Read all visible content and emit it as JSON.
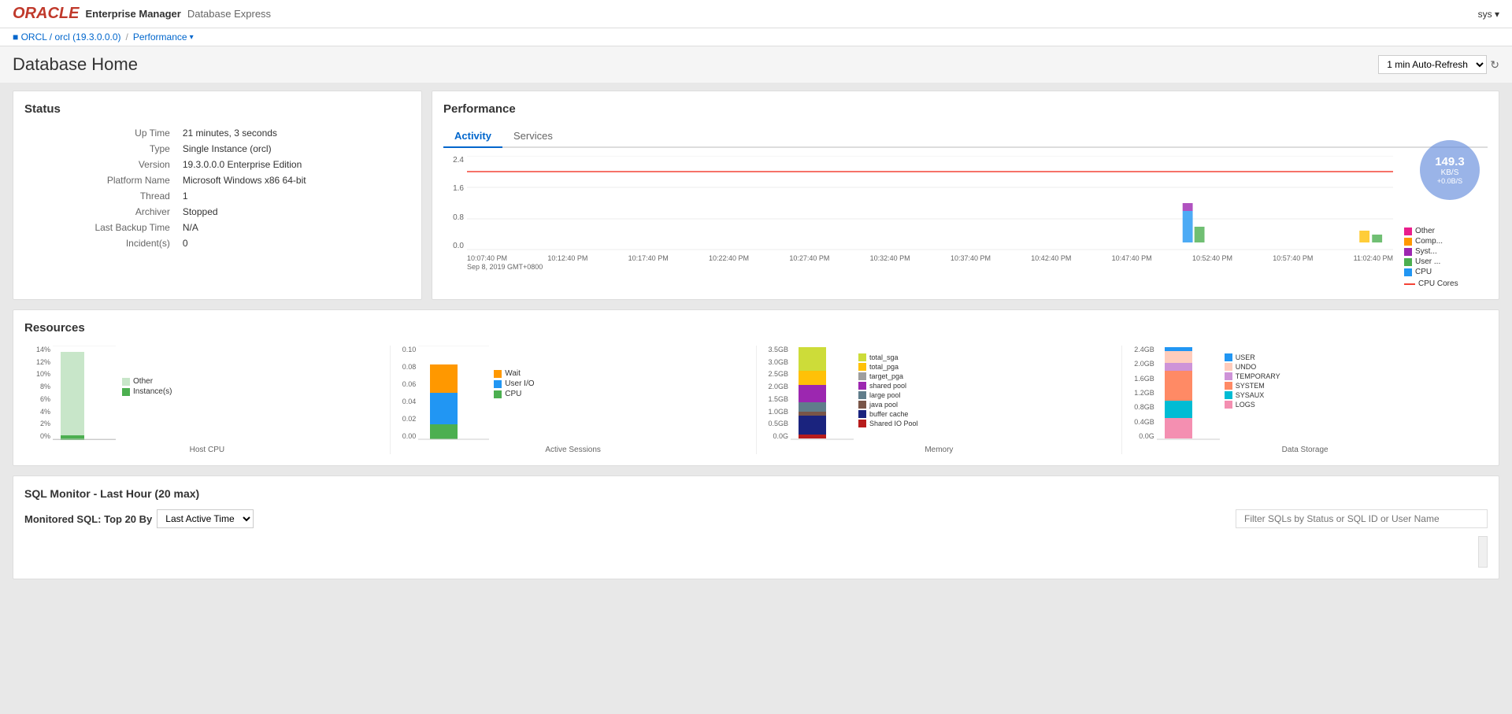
{
  "app": {
    "oracle_text": "ORACLE",
    "em_text": "Enterprise Manager",
    "db_express": "Database Express",
    "user": "sys",
    "user_caret": "▾"
  },
  "breadcrumb": {
    "db_link": "■ ORCL / orcl (19.3.0.0.0)",
    "separator": "/",
    "performance": "Performance",
    "caret": "▾"
  },
  "page": {
    "title": "Database Home",
    "refresh_label": "1 min Auto-Refresh",
    "refresh_icon": "↻"
  },
  "status": {
    "title": "Status",
    "rows": [
      {
        "label": "Up Time",
        "value": "21 minutes, 3 seconds"
      },
      {
        "label": "Type",
        "value": "Single Instance (orcl)"
      },
      {
        "label": "Version",
        "value": "19.3.0.0.0 Enterprise Edition"
      },
      {
        "label": "Platform Name",
        "value": "Microsoft Windows x86 64-bit"
      },
      {
        "label": "Thread",
        "value": "1"
      },
      {
        "label": "Archiver",
        "value": "Stopped"
      },
      {
        "label": "Last Backup Time",
        "value": "N/A"
      },
      {
        "label": "Incident(s)",
        "value": "0"
      }
    ]
  },
  "performance": {
    "title": "Performance",
    "tabs": [
      "Activity",
      "Services"
    ],
    "active_tab": "Activity",
    "y_labels": [
      "2.4",
      "1.6",
      "0.8",
      "0.0"
    ],
    "x_labels": [
      "10:07:40 PM",
      "10:12:40 PM",
      "10:17:40 PM",
      "10:22:40 PM",
      "10:27:40 PM",
      "10:32:40 PM",
      "10:37:40 PM",
      "10:42:40 PM",
      "10:47:40 PM",
      "10:52:40 PM",
      "10:57:40 PM",
      "11:02:40 PM"
    ],
    "x_sublabel": "Sep 8, 2019 GMT+0800",
    "legend": [
      {
        "label": "Other",
        "color": "#e91e8c"
      },
      {
        "label": "Comp...",
        "color": "#ff9800"
      },
      {
        "label": "Syst...",
        "color": "#9c27b0"
      },
      {
        "label": "User ...",
        "color": "#4caf50"
      },
      {
        "label": "CPU",
        "color": "#2196f3"
      }
    ],
    "cpu_cores_label": "— CPU Cores",
    "network": {
      "speed": "149.3",
      "unit": "KB/S",
      "delta": "+0.0B/S"
    }
  },
  "resources": {
    "title": "Resources",
    "cpu": {
      "label": "Host CPU",
      "y_labels": [
        "14%",
        "12%",
        "10%",
        "8%",
        "6%",
        "4%",
        "2%",
        "0%"
      ],
      "legend": [
        {
          "label": "Other",
          "color": "#c8e6c9"
        },
        {
          "label": "Instance(s)",
          "color": "#4caf50"
        }
      ]
    },
    "active_sessions": {
      "label": "Active Sessions",
      "y_labels": [
        "0.10",
        "0.08",
        "0.06",
        "0.04",
        "0.02",
        "0.00"
      ],
      "legend": [
        {
          "label": "Wait",
          "color": "#ff9800"
        },
        {
          "label": "User I/O",
          "color": "#2196f3"
        },
        {
          "label": "CPU",
          "color": "#4caf50"
        }
      ]
    },
    "memory": {
      "label": "Memory",
      "y_labels": [
        "3.5GB",
        "3.0GB",
        "2.5GB",
        "2.0GB",
        "1.5GB",
        "1.0GB",
        "0.5GB",
        "0.0G"
      ],
      "legend": [
        {
          "label": "total_sga",
          "color": "#cddc39"
        },
        {
          "label": "total_pga",
          "color": "#ffc107"
        },
        {
          "label": "target_pga",
          "color": "#9e9e9e"
        },
        {
          "label": "shared pool",
          "color": "#9c27b0"
        },
        {
          "label": "large pool",
          "color": "#607d8b"
        },
        {
          "label": "java pool",
          "color": "#795548"
        },
        {
          "label": "buffer cache",
          "color": "#1a237e"
        },
        {
          "label": "Shared IO Pool",
          "color": "#b71c1c"
        }
      ]
    },
    "data_storage": {
      "label": "Data Storage",
      "y_labels": [
        "2.4GB",
        "2.0GB",
        "1.6GB",
        "1.2GB",
        "0.8GB",
        "0.4GB",
        "0.0G"
      ],
      "legend": [
        {
          "label": "USER",
          "color": "#2196f3"
        },
        {
          "label": "UNDO",
          "color": "#ffccbc"
        },
        {
          "label": "TEMPORARY",
          "color": "#ce93d8"
        },
        {
          "label": "SYSTEM",
          "color": "#ff8a65"
        },
        {
          "label": "SYSAUX",
          "color": "#00bcd4"
        },
        {
          "label": "LOGS",
          "color": "#f48fb1"
        }
      ]
    }
  },
  "sql_monitor": {
    "section_title": "SQL Monitor - Last Hour (20 max)",
    "top20_label": "Monitored SQL: Top 20 By",
    "sort_by": "Last Active Time",
    "sort_caret": "▾",
    "filter_placeholder": "Filter SQLs by Status or SQL ID or User Name"
  }
}
